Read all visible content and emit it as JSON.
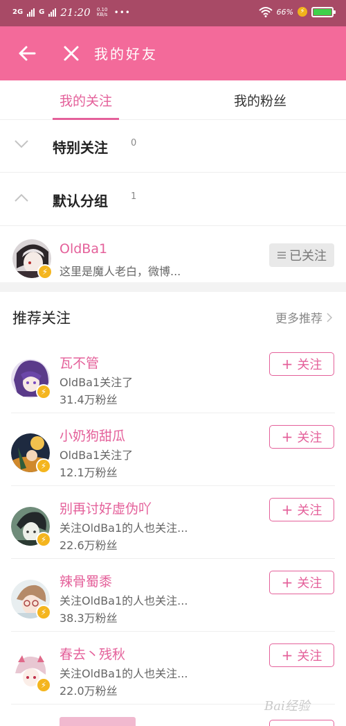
{
  "status_bar": {
    "network_1": "2G",
    "network_2": "G",
    "time": "21:20",
    "speed": "0.10 KB/s",
    "more": "•••",
    "battery_pct": "66%"
  },
  "header": {
    "title": "我的好友"
  },
  "tabs": [
    {
      "label": "我的关注",
      "active": true
    },
    {
      "label": "我的粉丝",
      "active": false
    }
  ],
  "groups": [
    {
      "name": "特别关注",
      "count": "0",
      "expanded": false
    },
    {
      "name": "默认分组",
      "count": "1",
      "expanded": true
    }
  ],
  "followed": {
    "name": "OldBa1",
    "desc": "这里是魔人老白，微博...",
    "button": "已关注"
  },
  "recommend": {
    "title": "推荐关注",
    "more": "更多推荐",
    "follow_label": "关注",
    "users": [
      {
        "name": "瓦不管",
        "desc": "OldBa1关注了",
        "fans": "31.4万粉丝"
      },
      {
        "name": "小奶狗甜瓜",
        "desc": "OldBa1关注了",
        "fans": "12.1万粉丝"
      },
      {
        "name": "别再讨好虚伪吖",
        "desc": "关注OldBa1的人也关注...",
        "fans": "22.6万粉丝"
      },
      {
        "name": "辣骨蜀黍",
        "desc": "关注OldBa1的人也关注...",
        "fans": "38.3万粉丝"
      },
      {
        "name": "春去丶残秋",
        "desc": "关注OldBa1的人也关注...",
        "fans": "22.0万粉丝"
      }
    ]
  },
  "colors": {
    "accent": "#e4609a",
    "header_bg": "#f36a9a",
    "statusbar_bg": "#a84a66",
    "badge": "#f4b51e"
  }
}
